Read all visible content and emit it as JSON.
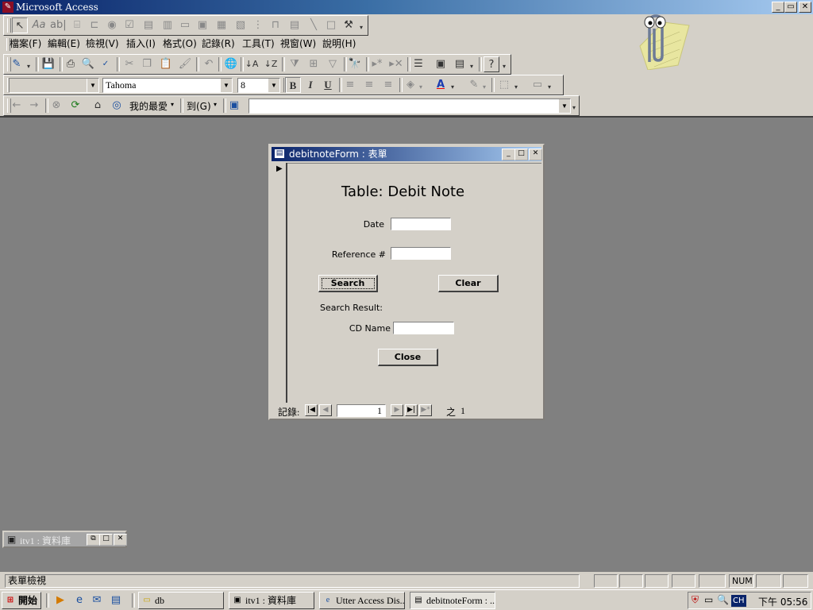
{
  "app": {
    "title": "Microsoft Access",
    "title_buttons": [
      "_",
      "▭",
      "✕"
    ]
  },
  "menu": [
    "檔案(F)",
    "編輯(E)",
    "檢視(V)",
    "插入(I)",
    "格式(O)",
    "記錄(R)",
    "工具(T)",
    "視窗(W)",
    "說明(H)"
  ],
  "formatting": {
    "object_combo": "",
    "font_combo": "Tahoma",
    "size_combo": "8",
    "bold": "B",
    "italic": "I",
    "underline": "U"
  },
  "web_toolbar": {
    "favorites": "我的最愛",
    "goto": "到(G)",
    "address": ""
  },
  "form_window": {
    "title": "debitnoteForm : 表單",
    "heading": "Table: Debit Note",
    "date_label": "Date",
    "date_value": "",
    "reference_label": "Reference #",
    "reference_value": "",
    "search_button": "Search",
    "clear_button": "Clear",
    "search_result_label": "Search Result:",
    "cd_name_label": "CD Name",
    "cd_name_value": "",
    "close_button": "Close",
    "nav": {
      "record_label": "記錄:",
      "current": "1",
      "of_label": "之",
      "total": "1"
    }
  },
  "db_window": {
    "title": "itv1 : 資料庫"
  },
  "statusbar": {
    "text": "表單檢視",
    "num": "NUM"
  },
  "taskbar": {
    "start": "開始",
    "buttons": [
      "db",
      "itv1 : 資料庫",
      "Utter Access Dis...",
      "debitnoteForm : ..."
    ],
    "tray_ch": "CH",
    "clock": "下午 05:56"
  },
  "colors": {
    "titlebar_start": "#0a246a",
    "titlebar_end": "#a6caf0",
    "mdi_background": "#808080",
    "face": "#d4d0c8"
  }
}
